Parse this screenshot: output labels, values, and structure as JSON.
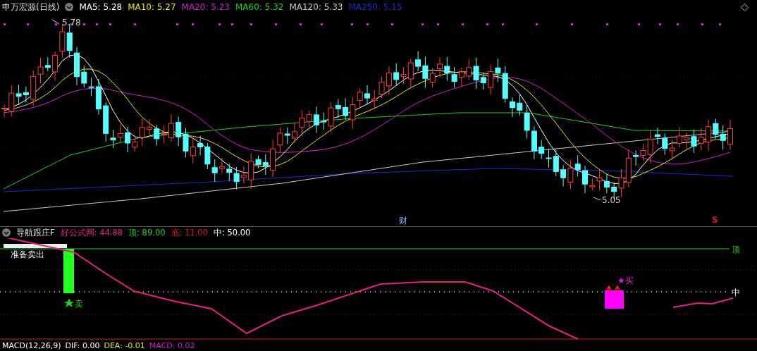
{
  "main_chart": {
    "legend": {
      "title": "申万宏源(日线)",
      "items": [
        {
          "label": "MA5: 5.28",
          "color": "#ffffff"
        },
        {
          "label": "MA10: 5.27",
          "color": "#e6e600"
        },
        {
          "label": "MA20: 5.23",
          "color": "#d21ed2"
        },
        {
          "label": "MA60: 5.32",
          "color": "#1ed21e"
        },
        {
          "label": "MA120: 5.33",
          "color": "#c8c8c8"
        },
        {
          "label": "MA250: 5.15",
          "color": "#1a2ad8"
        }
      ]
    },
    "high_label": "5.78",
    "low_label": "5.05",
    "markers": [
      {
        "kind": "finance",
        "text": "财"
      },
      {
        "kind": "signal",
        "text": "S"
      }
    ]
  },
  "indicator": {
    "legend": {
      "title": "导航跟庄F",
      "items": [
        {
          "label": "好公式网: 44.88",
          "color": "#e8207a"
        },
        {
          "label": "顶: 89.00",
          "color": "#22cc22"
        },
        {
          "label": "底: 11.00",
          "color": "#d81818"
        },
        {
          "label": "中: 50.00",
          "color": "#ffffff"
        }
      ]
    },
    "top_label": "顶",
    "mid_label": "中",
    "sell_warning": "准备卖出",
    "sell_signal": "卖",
    "buy_signal": "★买"
  },
  "macd_legend": {
    "items": [
      {
        "label": "MACD(12,26,9)",
        "color": "#ffffff"
      },
      {
        "label": "DIF: 0.00",
        "color": "#ffffff"
      },
      {
        "label": "DEA: -0.01",
        "color": "#e6e600"
      },
      {
        "label": "MACD: 0.02",
        "color": "#d21ed2"
      }
    ]
  }
}
